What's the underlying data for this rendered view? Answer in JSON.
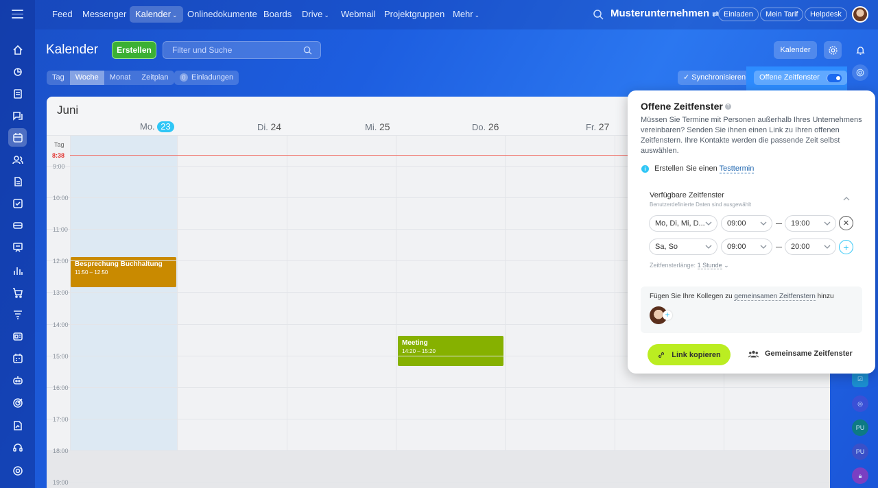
{
  "topbar": {
    "nav": [
      {
        "label": "Feed"
      },
      {
        "label": "Messenger"
      },
      {
        "label": "Kalender",
        "active": true,
        "has_menu": true
      },
      {
        "label": "Onlinedokumente"
      },
      {
        "label": "Boards"
      },
      {
        "label": "Drive",
        "has_menu": true
      },
      {
        "label": "Webmail"
      },
      {
        "label": "Projektgruppen"
      },
      {
        "label": "Mehr",
        "has_menu": true
      }
    ],
    "company": "Musterunternehmen",
    "invite_label": "Einladen",
    "tariff_label": "Mein Tarif",
    "helpdesk_label": "Helpdesk"
  },
  "calendar": {
    "title": "Kalender",
    "create_label": "Erstellen",
    "filter_placeholder": "Filter und Suche",
    "calendar_button": "Kalender",
    "views": [
      {
        "label": "Tag"
      },
      {
        "label": "Woche",
        "active": true
      },
      {
        "label": "Monat"
      },
      {
        "label": "Zeitplan"
      }
    ],
    "invitations_count": "0",
    "invitations_label": "Einladungen",
    "sync_label": "Synchronisieren",
    "open_slots_label": "Offene Zeitfenster",
    "month": "Juni",
    "days": [
      {
        "name": "Mo.",
        "num": "23",
        "today": true
      },
      {
        "name": "Di.",
        "num": "24"
      },
      {
        "name": "Mi.",
        "num": "25"
      },
      {
        "name": "Do.",
        "num": "26"
      },
      {
        "name": "Fr.",
        "num": "27"
      }
    ],
    "allday_label": "Tag",
    "now_time": "8:38",
    "hours": [
      "9:00",
      "10:00",
      "11:00",
      "12:00",
      "13:00",
      "14:00",
      "15:00",
      "16:00",
      "17:00",
      "18:00",
      "19:00"
    ],
    "events": [
      {
        "title": "Besprechung Buchhaltung",
        "time": "11:50 – 12:50",
        "day": 0,
        "color": "#c98a00"
      },
      {
        "title": "Meeting",
        "time": "14:20 – 15:20",
        "day": 3,
        "color": "#86b100"
      }
    ]
  },
  "popup": {
    "title": "Offene Zeitfenster",
    "description": "Müssen Sie Termine mit Personen außerhalb Ihres Unternehmens vereinbaren? Senden Sie ihnen einen Link zu Ihren offenen Zeitfenstern. Ihre Kontakte werden die passende Zeit selbst auswählen.",
    "test_prefix": "Erstellen Sie einen",
    "test_link": "Testtermin",
    "available_title": "Verfügbare Zeitfenster",
    "available_sub": "Benutzerdefinierte Daten sind ausgewählt",
    "rows": [
      {
        "days": "Mo, Di, Mi, D...",
        "from": "09:00",
        "to": "19:00"
      },
      {
        "days": "Sa, So",
        "from": "09:00",
        "to": "20:00"
      }
    ],
    "slot_length_label": "Zeitfensterlänge:",
    "slot_length_value": "1 Stunde",
    "colleague_prefix": "Fügen Sie Ihre Kollegen zu",
    "colleague_link": "gemeinsamen Zeitfenstern",
    "colleague_suffix": "hinzu",
    "copy_label": "Link kopieren",
    "shared_label": "Gemeinsame Zeitfenster"
  },
  "rightrail": {
    "badges": [
      "PU",
      "PU"
    ]
  },
  "colors": {
    "accent": "#2fc6f6",
    "create_green": "#3bb034",
    "copy_lime": "#bbed21",
    "now_red": "#e2302c"
  }
}
